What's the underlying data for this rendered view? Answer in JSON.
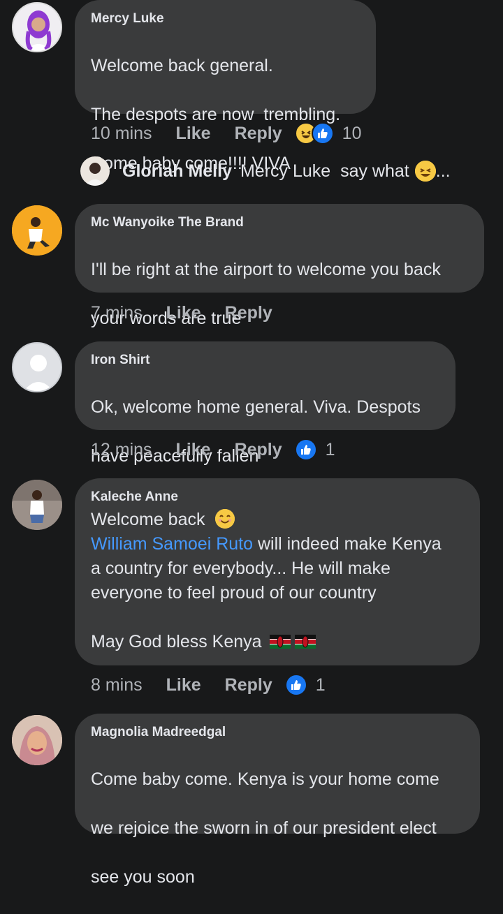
{
  "comments": [
    {
      "author": "Mercy Luke",
      "lines": [
        "Welcome back general.",
        "The despots are now  trembling.",
        "Come baby come!!!! VIVA"
      ],
      "time": "10 mins",
      "like": "Like",
      "reply": "Reply",
      "reaction_count": "10",
      "reactions": [
        "haha-icon",
        "like-icon"
      ]
    },
    {
      "author": "Mc Wanyoike The Brand",
      "lines": [
        "I'll be right at the airport to welcome you back",
        "your words are true"
      ],
      "time": "7 mins",
      "like": "Like",
      "reply": "Reply"
    },
    {
      "author": "Iron Shirt",
      "lines": [
        "Ok, welcome home general. Viva. Despots",
        "have peacefully fallen"
      ],
      "time": "12 mins",
      "like": "Like",
      "reply": "Reply",
      "reaction_count": "1",
      "reactions": [
        "like-icon"
      ]
    },
    {
      "author": "Kaleche Anne",
      "line1": "Welcome back",
      "mention": "William Samoei Ruto",
      "line2_rest": " will indeed make Kenya",
      "line3": "a country for everybody... He will make",
      "line4": "everyone to feel proud of our country",
      "line5": "May God bless Kenya",
      "time": "8 mins",
      "like": "Like",
      "reply": "Reply",
      "reaction_count": "1",
      "reactions": [
        "like-icon"
      ]
    },
    {
      "author": "Magnolia Madreedgal",
      "lines": [
        "Come baby come. Kenya is your home come",
        "we rejoice the sworn in of our president elect",
        "see you soon"
      ]
    }
  ],
  "reply": {
    "author": "Gloriah Melly",
    "text": "Mercy Luke  say what",
    "ellipsis": "..."
  },
  "colors": {
    "background": "#18191a",
    "bubble": "#3a3b3c",
    "mention": "#4599ff",
    "like_blue": "#1877f2",
    "haha_yellow": "#f7c944"
  }
}
